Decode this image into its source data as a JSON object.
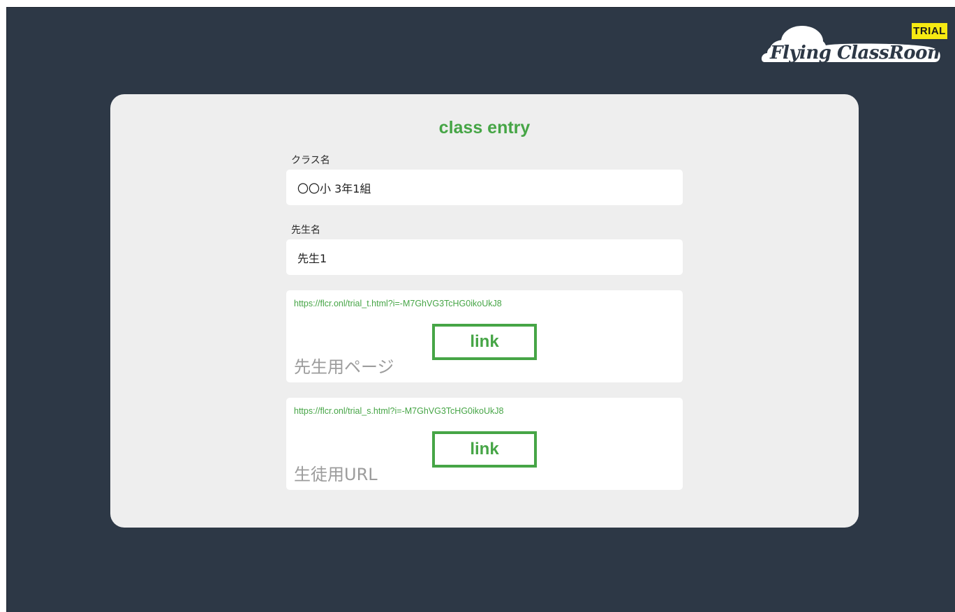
{
  "header": {
    "logo_text": "Flying ClassRoom",
    "badge": "TRIAL"
  },
  "form": {
    "title": "class entry",
    "class_name": {
      "label": "クラス名",
      "value": "〇〇小 3年1組"
    },
    "teacher_name": {
      "label": "先生名",
      "value": "先生1"
    },
    "teacher_link": {
      "url": "https://flcr.onl/trial_t.html?i=-M7GhVG3TcHG0ikoUkJ8",
      "button": "link",
      "caption": "先生用ページ"
    },
    "student_link": {
      "url": "https://flcr.onl/trial_s.html?i=-M7GhVG3TcHG0ikoUkJ8",
      "button": "link",
      "caption": "生徒用URL"
    }
  },
  "colors": {
    "background": "#2d3846",
    "card": "#eeeeee",
    "accent_green": "#46a546",
    "badge_yellow": "#f6ea12"
  }
}
